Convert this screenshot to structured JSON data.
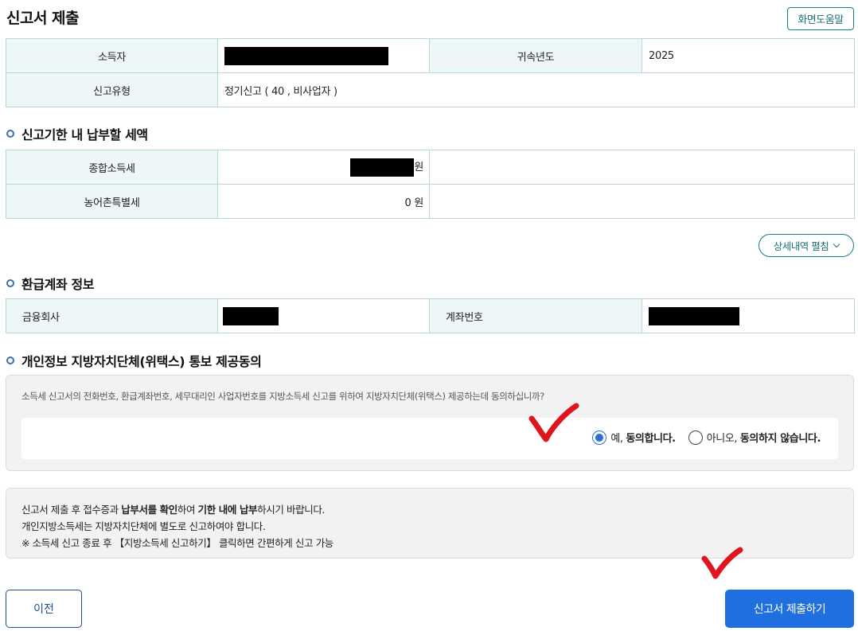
{
  "header": {
    "title": "신고서 제출",
    "help_label": "화면도움말"
  },
  "summary": {
    "income_earner_label": "소득자",
    "tax_year_label": "귀속년도",
    "tax_year_value": "2025",
    "filing_type_label": "신고유형",
    "filing_type_value": "정기신고 ( 40 , 비사업자 )"
  },
  "tax_section": {
    "title": "신고기한 내 납부할 세액",
    "rows": [
      {
        "label": "종합소득세",
        "amount": "",
        "unit": "원"
      },
      {
        "label": "농어촌특별세",
        "amount": "0",
        "unit": "원"
      }
    ],
    "expand_label": "상세내역 펼침"
  },
  "refund_section": {
    "title": "환급계좌 정보",
    "bank_label": "금융회사",
    "account_label": "계좌번호"
  },
  "consent_section": {
    "title": "개인정보 지방자치단체(위택스) 통보 제공동의",
    "question": "소득세 신고서의 전화번호, 환급계좌번호, 세무대리인 사업자번호를 지방소득세 신고를 위하여 지방자치단체(위택스) 제공하는데 동의하십니까?",
    "yes_prefix": "예, ",
    "yes_strong": "동의합니다.",
    "no_prefix": "아니오, ",
    "no_strong": "동의하지 않습니다.",
    "selected": "yes"
  },
  "notice": {
    "line1_a": "신고서 제출 후 접수증과 ",
    "line1_b": "납부서를 확인",
    "line1_c": "하여 ",
    "line1_d": "기한 내에 납부",
    "line1_e": "하시기 바랍니다.",
    "line2": "개인지방소득세는 지방자치단체에 별도로 신고하여야 합니다.",
    "line3": "※ 소득세 신고 종료 후 【지방소득세 신고하기】 클릭하면 간편하게 신고 가능"
  },
  "footer": {
    "prev_label": "이전",
    "submit_label": "신고서 제출하기"
  },
  "colors": {
    "accent": "#1f6fe0",
    "annotation_red": "#e0141e",
    "table_header_bg": "#eef7f8"
  }
}
